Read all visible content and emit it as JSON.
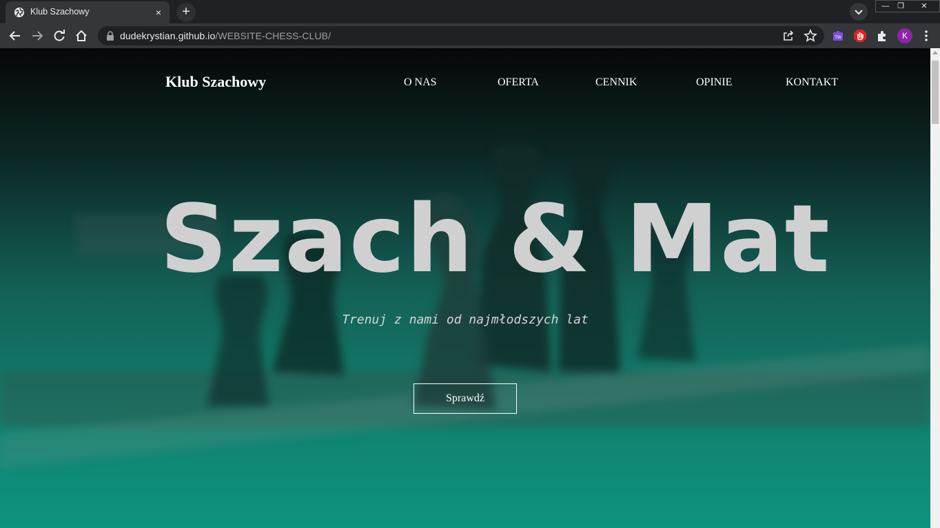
{
  "browser": {
    "tab": {
      "title": "Klub Szachowy",
      "close_glyph": "×",
      "favicon": "globe-icon"
    },
    "new_tab_glyph": "+",
    "window_controls": {
      "minimize": "—",
      "restore": "❐",
      "close": "✕"
    },
    "address_bar": {
      "host": "dudekrystian.github.io",
      "path": "/WEBSITE-CHESS-CLUB/"
    },
    "profile_initial": "K",
    "extensions": [
      "extension-tw-icon",
      "adblock-hand-icon",
      "puzzle-extensions-icon"
    ]
  },
  "site": {
    "logo": "Klub Szachowy",
    "nav": [
      "O NAS",
      "OFERTA",
      "CENNIK",
      "OPINIE",
      "KONTAKT"
    ],
    "hero": {
      "title": "Szach & Mat",
      "subtitle": "Trenuj z nami od najmłodszych lat",
      "cta": "Sprawdź"
    }
  },
  "colors": {
    "hero_gradient_top": "#050808",
    "hero_gradient_bottom": "#0d9381",
    "hero_title": "#d0d0d0",
    "text": "#ffffff"
  }
}
